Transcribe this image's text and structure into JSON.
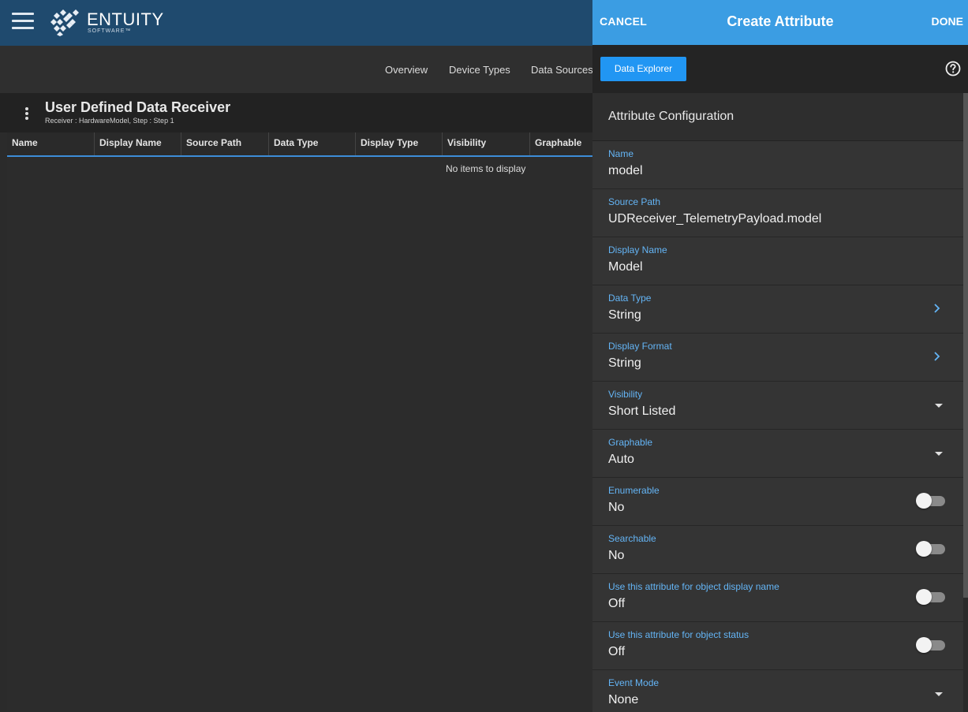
{
  "app": {
    "brand": "ENTUITY",
    "brand_sub": "SOFTWARE™"
  },
  "nav": {
    "tabs": [
      "Overview",
      "Device Types",
      "Data Sources"
    ]
  },
  "page": {
    "title": "User Defined Data Receiver",
    "subtitle": "Receiver : HardwareModel, Step : Step 1"
  },
  "grid": {
    "columns": [
      "Name",
      "Display Name",
      "Source Path",
      "Data Type",
      "Display Type",
      "Visibility",
      "Graphable"
    ],
    "empty_message": "No items to display"
  },
  "panel": {
    "cancel_label": "CANCEL",
    "title": "Create Attribute",
    "done_label": "DONE",
    "explorer_label": "Data Explorer",
    "section_title": "Attribute Configuration",
    "fields": [
      {
        "label": "Name",
        "value": "model",
        "control": "none"
      },
      {
        "label": "Source Path",
        "value": "UDReceiver_TelemetryPayload.model",
        "control": "none"
      },
      {
        "label": "Display Name",
        "value": "Model",
        "control": "none"
      },
      {
        "label": "Data Type",
        "value": "String",
        "control": "chevron"
      },
      {
        "label": "Display Format",
        "value": "String",
        "control": "chevron"
      },
      {
        "label": "Visibility",
        "value": "Short Listed",
        "control": "dropdown"
      },
      {
        "label": "Graphable",
        "value": "Auto",
        "control": "dropdown"
      },
      {
        "label": "Enumerable",
        "value": "No",
        "control": "toggle",
        "on": false
      },
      {
        "label": "Searchable",
        "value": "No",
        "control": "toggle",
        "on": false
      },
      {
        "label": "Use this attribute for object display name",
        "value": "Off",
        "control": "toggle",
        "on": false
      },
      {
        "label": "Use this attribute for object status",
        "value": "Off",
        "control": "toggle",
        "on": false
      },
      {
        "label": "Event Mode",
        "value": "None",
        "control": "dropdown"
      }
    ]
  },
  "colors": {
    "topbar": "#1f4a6e",
    "panel_header": "#3b9de3",
    "accent_button": "#2196f3",
    "field_label": "#64b5f6",
    "grid_header_underline": "#3d8dd8"
  },
  "icons": [
    "menu-icon",
    "entuity-logo-icon",
    "kebab-menu-icon",
    "help-icon",
    "chevron-right-icon",
    "caret-down-icon"
  ]
}
